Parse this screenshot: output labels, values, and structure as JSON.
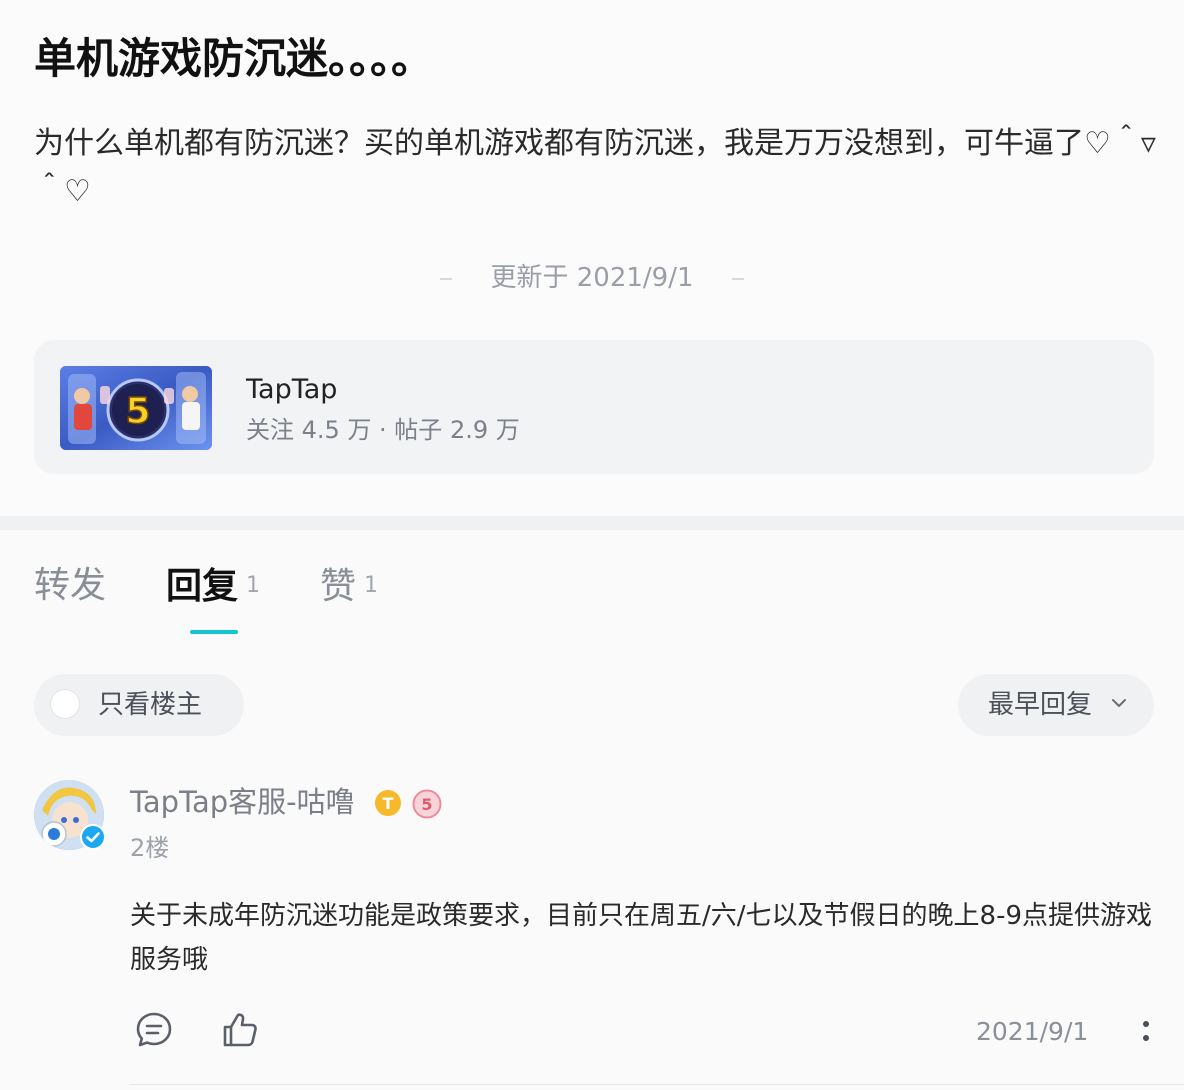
{
  "post": {
    "title": "单机游戏防沉迷。。。。",
    "body": "为什么单机都有防沉迷？买的单机游戏都有防沉迷，我是万万没想到，可牛逼了♡＾▿＾♡",
    "updated": "更新于 2021/9/1"
  },
  "app_card": {
    "name": "TapTap",
    "stats": "关注 4.5 万 · 帖子 2.9 万",
    "thumbnail_icon": "game-cover-image"
  },
  "tabs": [
    {
      "label": "转发",
      "count": ""
    },
    {
      "label": "回复",
      "count": "1"
    },
    {
      "label": "赞",
      "count": "1"
    }
  ],
  "active_tab": "回复",
  "accent_color": "#15c5ce",
  "filters": {
    "op_only_label": "只看楼主",
    "sort_label": "最早回复"
  },
  "reply": {
    "username": "TapTap客服-咕噜",
    "floor": "2楼",
    "content": "关于未成年防沉迷功能是政策要求，目前只在周五/六/七以及节假日的晚上8-9点提供游戏服务哦",
    "date": "2021/9/1",
    "badges": [
      "taptap-official-badge",
      "level-5-badge"
    ],
    "verified": true
  }
}
